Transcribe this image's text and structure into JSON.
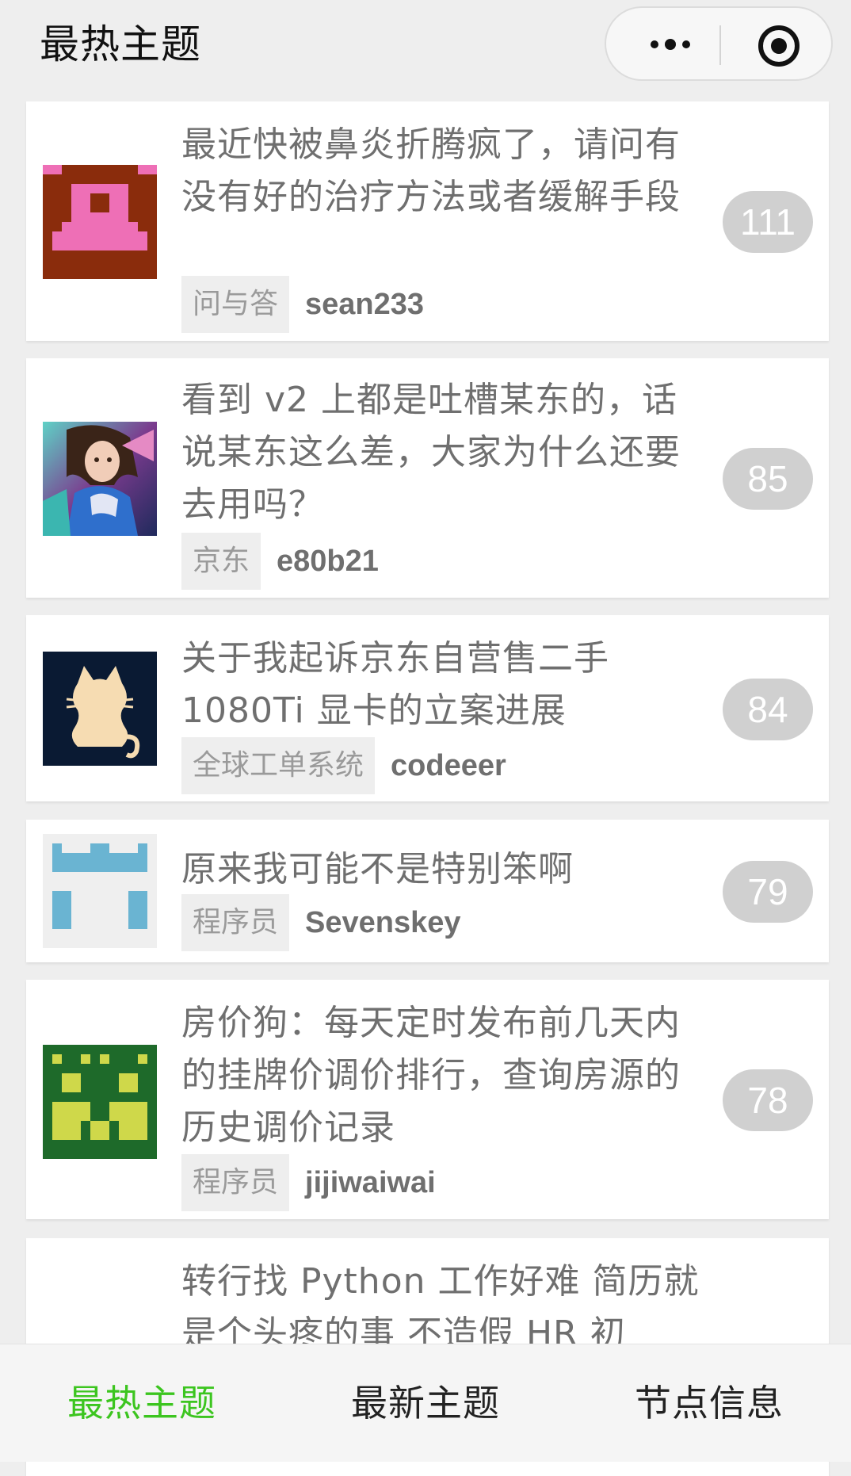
{
  "header": {
    "title": "最热主题",
    "more_icon": "more-horizontal-icon",
    "close_icon": "target-close-icon"
  },
  "topics": [
    {
      "title": "最近快被鼻炎折腾疯了，请问有没有好的治疗方法或者缓解手段",
      "node": "问与答",
      "username": "sean233",
      "replies": "111",
      "avatar_icon": "pixel-avatar-brown-pink"
    },
    {
      "title": "看到 v2 上都是吐槽某东的，话说某东这么差，大家为什么还要去用吗？",
      "node": "京东",
      "username": "e80b21",
      "replies": "85",
      "avatar_icon": "anime-character-avatar"
    },
    {
      "title": "关于我起诉京东自营售二手 1080Ti 显卡的立案进展",
      "node": "全球工单系统",
      "username": "codeeer",
      "replies": "84",
      "avatar_icon": "cat-avatar"
    },
    {
      "title": "原来我可能不是特别笨啊",
      "node": "程序员",
      "username": "Sevenskey",
      "replies": "79",
      "avatar_icon": "pixel-avatar-blue"
    },
    {
      "title": "房价狗：每天定时发布前几天内的挂牌价调价排行，查询房源的历史调价记录",
      "node": "程序员",
      "username": "jijiwaiwai",
      "replies": "78",
      "avatar_icon": "pixel-avatar-green-yellow"
    },
    {
      "title": "转行找 Python 工作好难 简历就是个头疼的事 不造假 HR 初",
      "node": "",
      "username": "",
      "replies": "",
      "avatar_icon": ""
    }
  ],
  "tabbar": {
    "tabs": [
      {
        "label": "最热主题",
        "active": true
      },
      {
        "label": "最新主题",
        "active": false
      },
      {
        "label": "节点信息",
        "active": false
      }
    ],
    "active_color": "#3cc51f"
  }
}
